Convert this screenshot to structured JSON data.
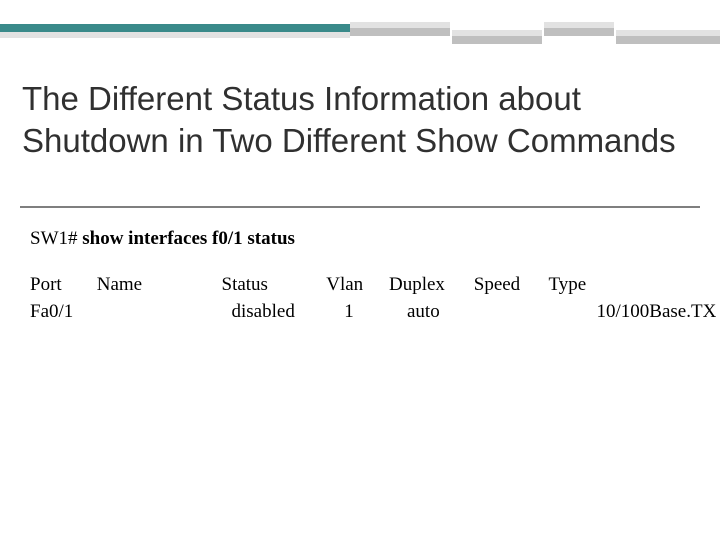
{
  "title": "The Different Status Information about Shutdown in Two Different Show Commands",
  "cli": {
    "prompt": "SW1# ",
    "command": "show interfaces f0/1 status"
  },
  "table": {
    "headers": {
      "port": "Port",
      "name": "Name",
      "status": "Status",
      "vlan": "Vlan",
      "duplex": "Duplex",
      "speed": "Speed",
      "type": "Type"
    },
    "row": {
      "port": "Fa0/1",
      "name": "",
      "status": "disabled",
      "vlan": "1",
      "duplex": "auto",
      "speed": "",
      "type": "10/100Base.TX"
    }
  }
}
